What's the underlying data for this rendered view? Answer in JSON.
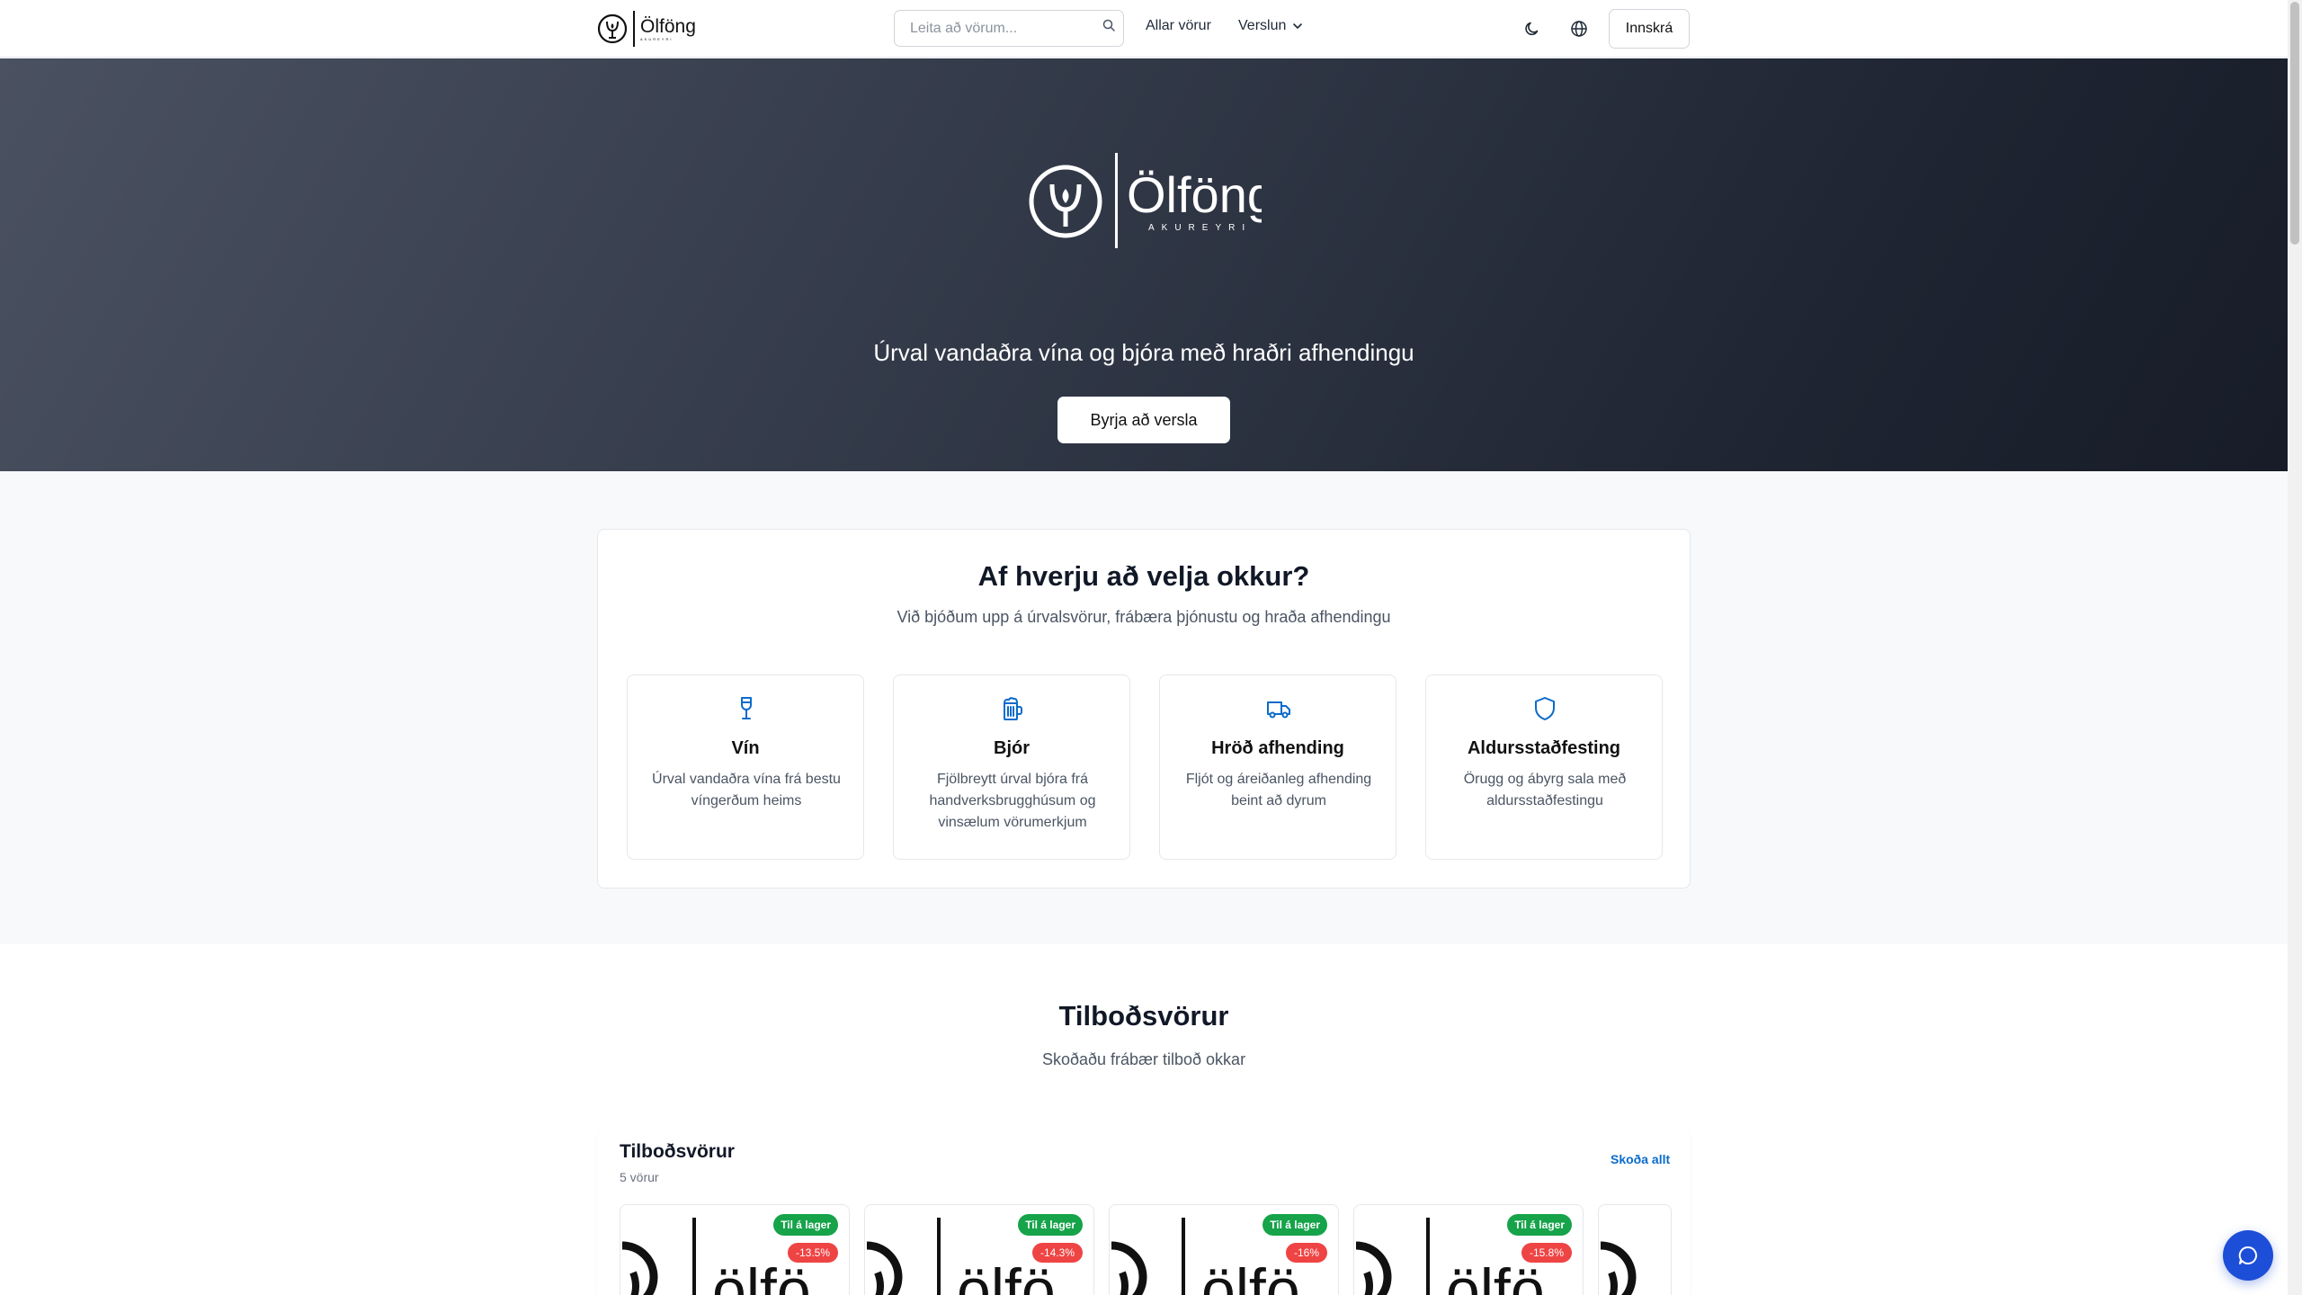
{
  "header": {
    "brand": "Ölföng",
    "brand_sub": "AKUREYRI",
    "search_placeholder": "Leita að vörum...",
    "nav_all_products": "Allar vörur",
    "nav_shop": "Verslun",
    "login": "Innskrá"
  },
  "hero": {
    "brand": "Ölföng",
    "brand_sub": "AKUREYRI",
    "tagline": "Úrval vandaðra vína og bjóra með hraðri afhendingu",
    "cta": "Byrja að versla"
  },
  "why": {
    "title": "Af hverju að velja okkur?",
    "subtitle": "Við bjóðum upp á úrvalsvörur, frábæra þjónustu og hraða afhendingu",
    "features": [
      {
        "icon": "wine-glass-icon",
        "title": "Vín",
        "desc": "Úrval vandaðra vína frá bestu víngerðum heims"
      },
      {
        "icon": "beer-mug-icon",
        "title": "Bjór",
        "desc": "Fjölbreytt úrval bjóra frá handverksbrugghúsum og vinsælum vörumerkjum"
      },
      {
        "icon": "truck-icon",
        "title": "Hröð afhending",
        "desc": "Fljót og áreiðanleg afhending beint að dyrum"
      },
      {
        "icon": "shield-icon",
        "title": "Aldursstaðfesting",
        "desc": "Örugg og ábyrg sala með aldursstaðfestingu"
      }
    ]
  },
  "offers": {
    "title": "Tilboðsvörur",
    "subtitle": "Skoðaðu frábær tilboð okkar",
    "panel_title": "Tilboðsvörur",
    "panel_count": "5 vörur",
    "see_all": "Skoða allt",
    "products": [
      {
        "stock": "Til á lager",
        "discount": "-13.5%"
      },
      {
        "stock": "Til á lager",
        "discount": "-14.3%"
      },
      {
        "stock": "Til á lager",
        "discount": "-16%"
      },
      {
        "stock": "Til á lager",
        "discount": "-15.8%"
      }
    ]
  },
  "colors": {
    "accent": "#0b6bcb",
    "in_stock": "#16a34a",
    "discount": "#ef4444",
    "chat": "#1d4ed8",
    "hero_dark": "#1e2431"
  }
}
